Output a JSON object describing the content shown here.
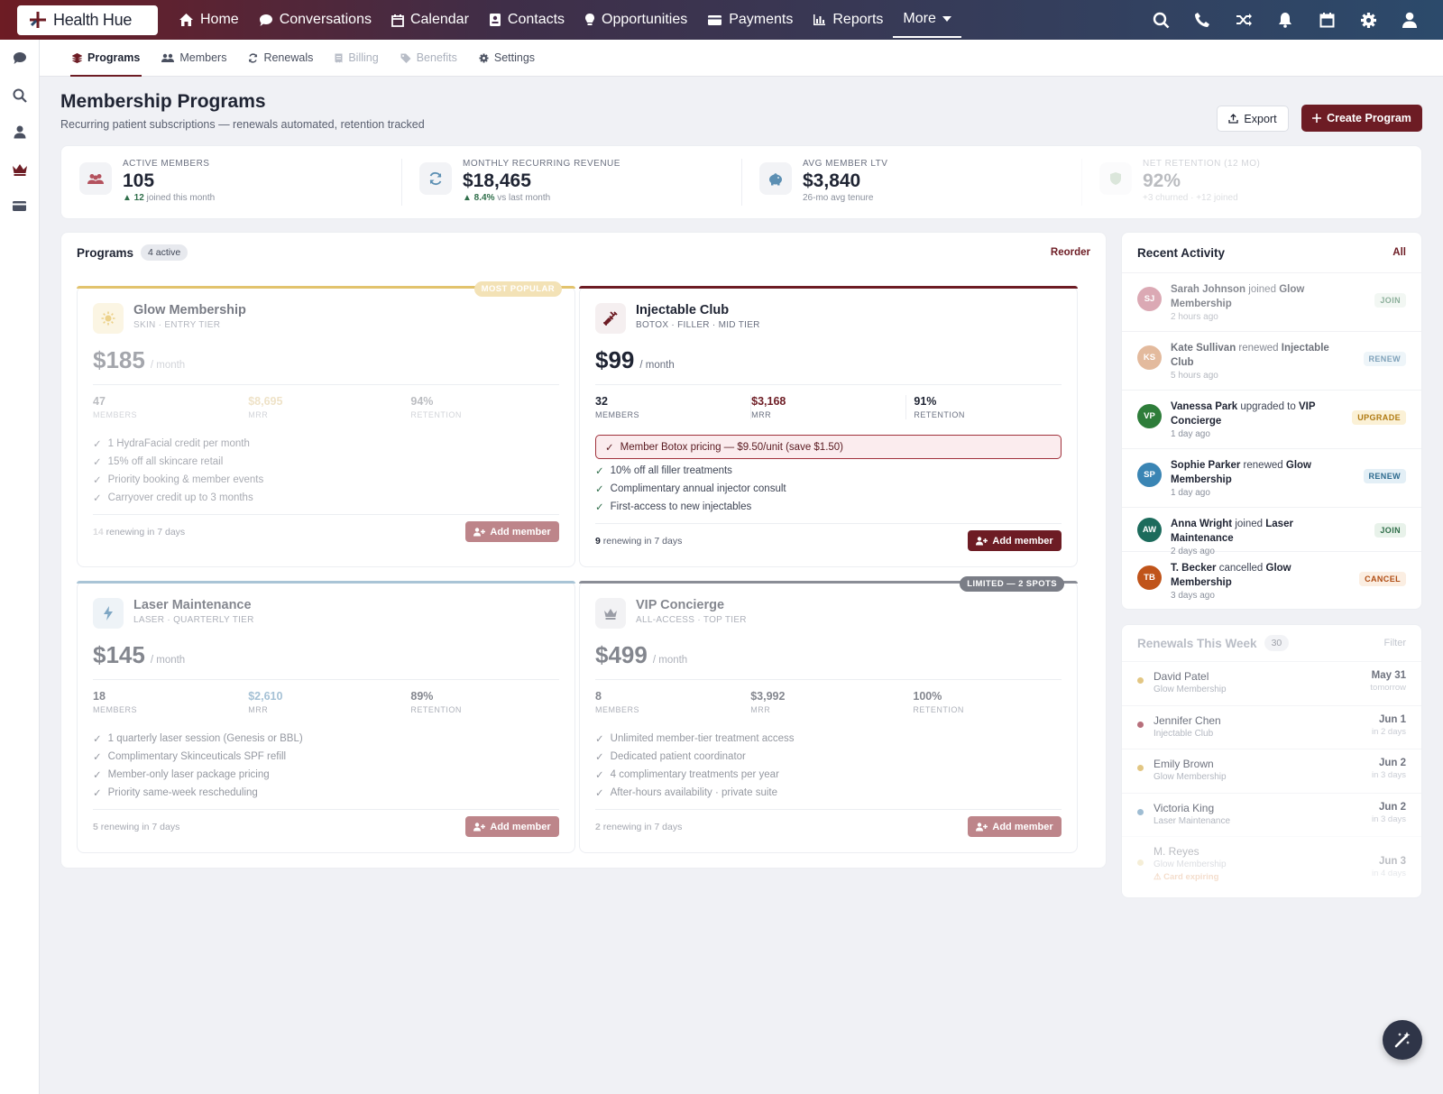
{
  "brand": {
    "name": "Health Hue"
  },
  "nav": [
    {
      "label": "Home",
      "icon": "home-icon"
    },
    {
      "label": "Conversations",
      "icon": "chat-icon"
    },
    {
      "label": "Calendar",
      "icon": "calendar-icon"
    },
    {
      "label": "Contacts",
      "icon": "contact-card-icon"
    },
    {
      "label": "Opportunities",
      "icon": "lightbulb-icon"
    },
    {
      "label": "Payments",
      "icon": "credit-card-icon"
    },
    {
      "label": "Reports",
      "icon": "bar-chart-icon"
    },
    {
      "label": "More",
      "icon": "caret-down-icon"
    }
  ],
  "top_icons": [
    "search-icon",
    "phone-icon",
    "shuffle-icon",
    "bell-icon",
    "calendar-icon",
    "gear-icon",
    "user-icon"
  ],
  "sidebar_icons": [
    "chat-icon",
    "search-icon",
    "user-icon",
    "crown-icon",
    "credit-card-icon"
  ],
  "subnav": [
    {
      "label": "Programs",
      "icon": "layers-icon",
      "state": "active"
    },
    {
      "label": "Members",
      "icon": "users-icon",
      "state": "normal"
    },
    {
      "label": "Renewals",
      "icon": "refresh-icon",
      "state": "normal"
    },
    {
      "label": "Billing",
      "icon": "receipt-icon",
      "state": "disabled"
    },
    {
      "label": "Benefits",
      "icon": "tag-icon",
      "state": "disabled"
    },
    {
      "label": "Settings",
      "icon": "gear-icon",
      "state": "normal"
    }
  ],
  "page": {
    "title": "Membership Programs",
    "subtitle": "Recurring patient subscriptions — renewals automated, retention tracked",
    "export_label": "Export",
    "create_label": "Create Program"
  },
  "stats": [
    {
      "label": "Active Members",
      "value": "105",
      "note_strong": "▲ 12",
      "note": "joined this month"
    },
    {
      "label": "Monthly Recurring Revenue",
      "value": "$18,465",
      "note_strong": "▲ 8.4%",
      "note": "vs last month"
    },
    {
      "label": "Avg Member LTV",
      "value": "$3,840",
      "note_strong": "",
      "note": "26-mo avg tenure"
    },
    {
      "label": "Net Retention (12 mo)",
      "value": "92%",
      "note_strong": "",
      "note": "+3 churned · +12 joined"
    }
  ],
  "programs_panel": {
    "title": "Programs",
    "badge": "4 active",
    "action": "Reorder"
  },
  "programs": [
    {
      "name": "Glow Membership",
      "tier": "SKIN · ENTRY TIER",
      "price": "$185",
      "unit": "/ month",
      "flag": "MOST POPULAR",
      "accent": "#e2c36d",
      "stats": [
        {
          "value": "47",
          "label": "MEMBERS"
        },
        {
          "value": "$8,695",
          "label": "MRR"
        },
        {
          "value": "94%",
          "label": "RETENTION"
        }
      ],
      "features": [
        "1 HydraFacial credit per month",
        "15% off all skincare retail",
        "Priority booking & member events",
        "Carryover credit up to 3 months"
      ],
      "renewing_count": "14",
      "renewing_text": "renewing in 7 days",
      "add_label": "Add member"
    },
    {
      "name": "Injectable Club",
      "tier": "BOTOX · FILLER · MID TIER",
      "price": "$99",
      "unit": "/ month",
      "flag": "",
      "accent": "#6d1c24",
      "stats": [
        {
          "value": "32",
          "label": "MEMBERS"
        },
        {
          "value": "$3,168",
          "label": "MRR"
        },
        {
          "value": "91%",
          "label": "RETENTION"
        }
      ],
      "highlight": "Member Botox pricing — $9.50/unit (save $1.50)",
      "features": [
        "10% off all filler treatments",
        "Complimentary annual injector consult",
        "First-access to new injectables"
      ],
      "renewing_count": "9",
      "renewing_text": "renewing in 7 days",
      "add_label": "Add member"
    },
    {
      "name": "Laser Maintenance",
      "tier": "LASER · QUARTERLY TIER",
      "price": "$145",
      "unit": "/ month",
      "flag": "",
      "accent": "#a9c4d6",
      "stats": [
        {
          "value": "18",
          "label": "MEMBERS"
        },
        {
          "value": "$2,610",
          "label": "MRR"
        },
        {
          "value": "89%",
          "label": "RETENTION"
        }
      ],
      "features": [
        "1 quarterly laser session (Genesis or BBL)",
        "Complimentary Skinceuticals SPF refill",
        "Member-only laser package pricing",
        "Priority same-week rescheduling"
      ],
      "renewing_count": "5",
      "renewing_text": "renewing in 7 days",
      "add_label": "Add member"
    },
    {
      "name": "VIP Concierge",
      "tier": "ALL-ACCESS · TOP TIER",
      "price": "$499",
      "unit": "/ month",
      "flag": "LIMITED — 2 SPOTS",
      "accent": "#8a8d96",
      "stats": [
        {
          "value": "8",
          "label": "MEMBERS"
        },
        {
          "value": "$3,992",
          "label": "MRR"
        },
        {
          "value": "100%",
          "label": "RETENTION"
        }
      ],
      "features": [
        "Unlimited member-tier treatment access",
        "Dedicated patient coordinator",
        "4 complimentary treatments per year",
        "After-hours availability · private suite"
      ],
      "renewing_count": "2",
      "renewing_text": "renewing in 7 days",
      "add_label": "Add member"
    }
  ],
  "activity": {
    "title": "Recent Activity",
    "action": "All",
    "items": [
      {
        "initials": "SJ",
        "name": "Sarah Johnson",
        "verb": "joined",
        "target": "Glow Membership",
        "time": "2 hours ago",
        "tag": "JOIN",
        "color": "#b0435a"
      },
      {
        "initials": "KS",
        "name": "Kate Sullivan",
        "verb": "renewed",
        "target": "Injectable Club",
        "time": "5 hours ago",
        "tag": "RENEW",
        "color": "#c8773e"
      },
      {
        "initials": "VP",
        "name": "Vanessa Park",
        "verb": "upgraded to",
        "target": "VIP Concierge",
        "time": "1 day ago",
        "tag": "UPGRADE",
        "color": "#2e7d3a"
      },
      {
        "initials": "SP",
        "name": "Sophie Parker",
        "verb": "renewed",
        "target": "Glow Membership",
        "time": "1 day ago",
        "tag": "RENEW",
        "color": "#3a85b4"
      },
      {
        "initials": "AW",
        "name": "Anna Wright",
        "verb": "joined",
        "target": "Laser Maintenance",
        "time": "2 days ago",
        "tag": "JOIN",
        "color": "#1c6b5c"
      },
      {
        "initials": "TB",
        "name": "T. Becker",
        "verb": "cancelled",
        "target": "Glow Membership",
        "time": "3 days ago",
        "tag": "CANCEL",
        "color": "#c0541a"
      }
    ]
  },
  "renewals": {
    "title": "Renewals This Week",
    "badge": "30",
    "action": "Filter",
    "items": [
      {
        "name": "David Patel",
        "program": "Glow Membership",
        "date": "May 31",
        "when": "tomorrow",
        "dot": "#d9b45a"
      },
      {
        "name": "Jennifer Chen",
        "program": "Injectable Club",
        "date": "Jun 1",
        "when": "in 2 days",
        "dot": "#a04050"
      },
      {
        "name": "Emily Brown",
        "program": "Glow Membership",
        "date": "Jun 2",
        "when": "in 3 days",
        "dot": "#d9b45a"
      },
      {
        "name": "Victoria King",
        "program": "Laser Maintenance",
        "date": "Jun 2",
        "when": "in 3 days",
        "dot": "#7fa7c4"
      },
      {
        "name": "M. Reyes",
        "program": "Glow Membership",
        "date": "Jun 3",
        "when": "in 4 days",
        "warning": "⚠ Card expiring",
        "dot": "#e3d08f"
      }
    ]
  }
}
